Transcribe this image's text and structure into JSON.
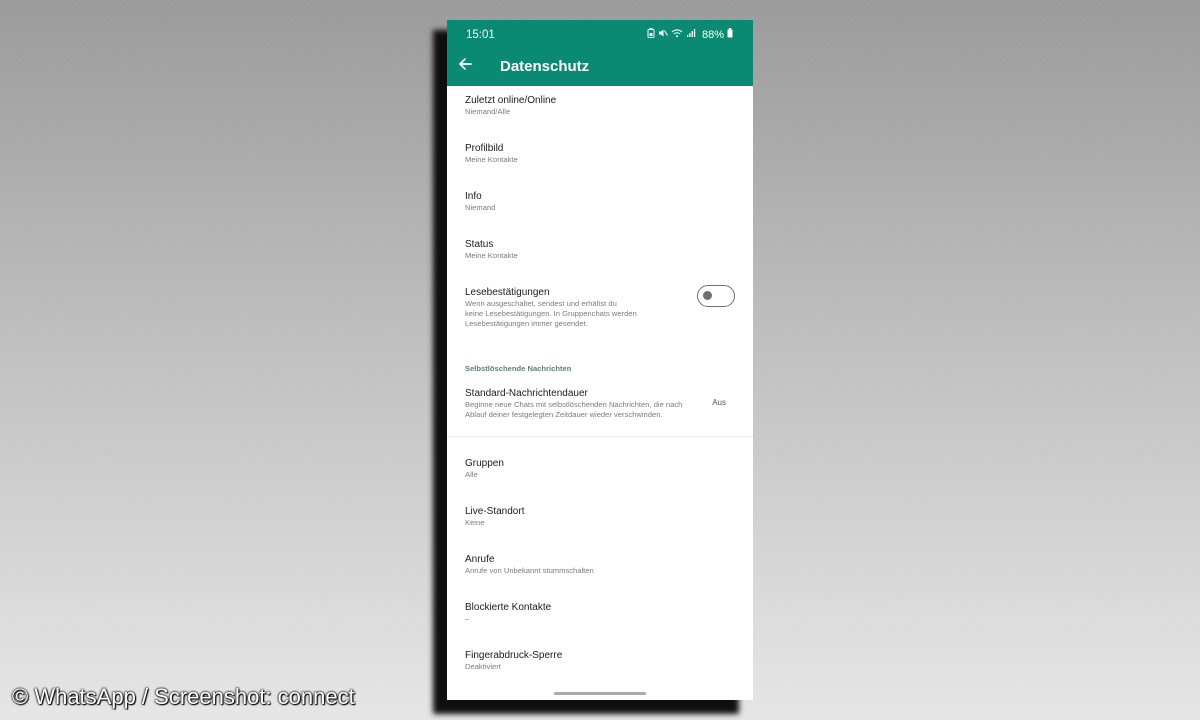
{
  "status_bar": {
    "time": "15:01",
    "battery": "88%"
  },
  "header": {
    "title": "Datenschutz",
    "back_icon": "arrow-left-icon"
  },
  "items": [
    {
      "title": "Zuletzt online/Online",
      "subtitle": "Niemand/Alle"
    },
    {
      "title": "Profilbild",
      "subtitle": "Meine Kontakte"
    },
    {
      "title": "Info",
      "subtitle": "Niemand"
    },
    {
      "title": "Status",
      "subtitle": "Meine Kontakte"
    }
  ],
  "read_receipts": {
    "title": "Lesebestätigungen",
    "desc": [
      "Wenn ausgeschaltet, sendest und erhältst du",
      "keine Lesebestätigungen. In Gruppenchats werden",
      "Lesebestätigungen immer gesendet."
    ],
    "enabled": false
  },
  "disappearing": {
    "section": "Selbstlöschende Nachrichten",
    "title": "Standard-Nachrichtendauer",
    "desc": [
      "Beginne neue Chats mit selbstlöschenden Nachrichten, die nach",
      "Ablauf deiner festgelegten Zeitdauer wieder verschwinden."
    ],
    "value": "Aus"
  },
  "items2": [
    {
      "title": "Gruppen",
      "subtitle": "Alle"
    },
    {
      "title": "Live-Standort",
      "subtitle": "Keine"
    },
    {
      "title": "Anrufe",
      "subtitle": "Anrufe von Unbekannt stummschalten"
    },
    {
      "title": "Blockierte Kontakte",
      "subtitle": "–"
    },
    {
      "title": "Fingerabdruck-Sperre",
      "subtitle": "Deaktiviert"
    }
  ],
  "credit": "© WhatsApp / Screenshot: connect",
  "colors": {
    "accent": "#0a8a72",
    "section": "#5b7f78"
  }
}
